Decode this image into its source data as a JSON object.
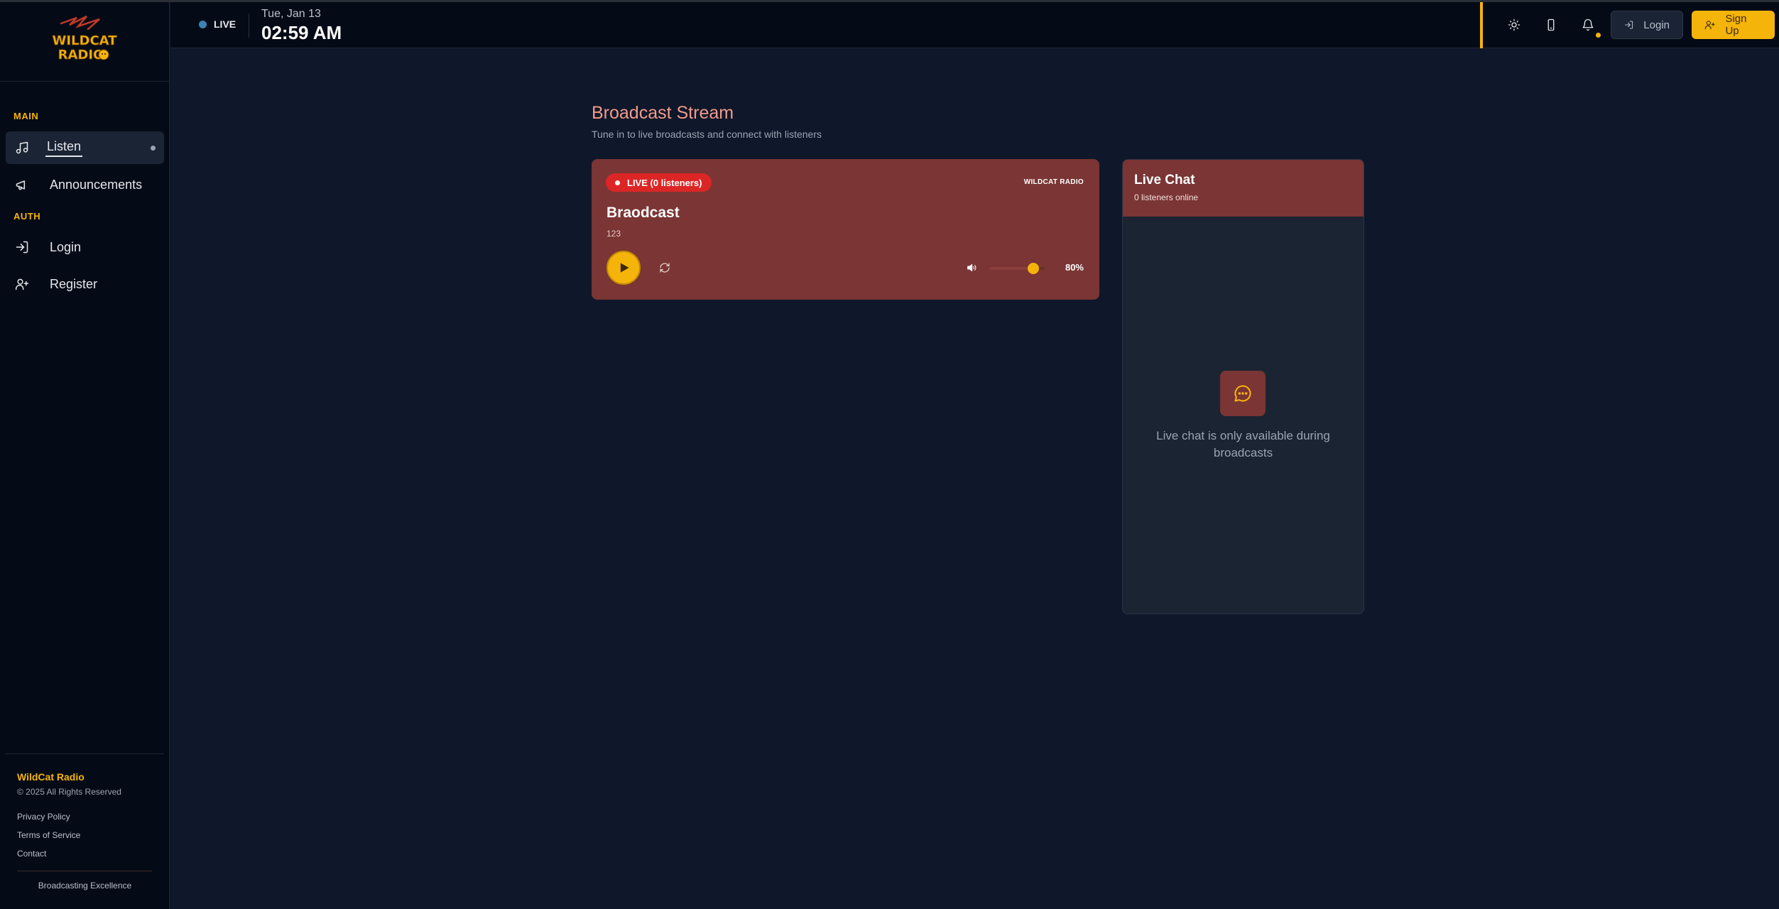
{
  "sidebar": {
    "logo_text_line1": "WILDCAT",
    "logo_text_line2": "RADIO",
    "sections": {
      "main": "MAIN",
      "auth": "AUTH"
    },
    "items": [
      {
        "label": "Listen",
        "icon": "music-note-icon",
        "active": true
      },
      {
        "label": "Announcements",
        "icon": "megaphone-icon",
        "active": false
      },
      {
        "label": "Login",
        "icon": "login-icon",
        "active": false
      },
      {
        "label": "Register",
        "icon": "user-plus-icon",
        "active": false
      }
    ],
    "footer": {
      "brand": "WildCat Radio",
      "copyright": "© 2025 All Rights Reserved",
      "links": [
        "Privacy Policy",
        "Terms of Service",
        "Contact"
      ],
      "tagline": "Broadcasting Excellence"
    }
  },
  "header": {
    "live_label": "LIVE",
    "date": "Tue, Jan 13",
    "time": "02:59 AM",
    "icons": [
      "sun-icon",
      "phone-icon",
      "bell-icon"
    ],
    "login_label": "Login",
    "signup_label": "Sign Up"
  },
  "main": {
    "title": "Broadcast Stream",
    "subtitle": "Tune in to live broadcasts and connect with listeners",
    "player": {
      "live_badge": "LIVE (0 listeners)",
      "brand": "WILDCAT RADIO",
      "broadcast_title": "Braodcast",
      "broadcast_subtitle": "123",
      "volume_percent": 80,
      "volume_label": "80%"
    },
    "chat": {
      "title": "Live Chat",
      "online": "0 listeners online",
      "empty_message": "Live chat is only available during broadcasts"
    }
  },
  "colors": {
    "accent": "#f5b40a",
    "panel": "#7a3534",
    "live_red": "#dc2626",
    "background": "#0f172a",
    "sidebar": "#050b16"
  }
}
